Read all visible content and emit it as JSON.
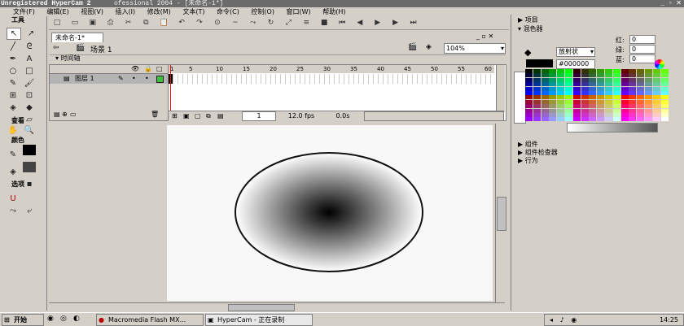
{
  "titlebar": {
    "title": "Unregistered HyperCam 2",
    "rest": "ofessional 2004 - [未命名-1*]"
  },
  "menu": [
    "文件(F)",
    "编辑(E)",
    "视图(V)",
    "插入(I)",
    "修改(M)",
    "文本(T)",
    "命令(C)",
    "控制(O)",
    "窗口(W)",
    "帮助(H)"
  ],
  "tools": {
    "title": "工具",
    "view_label": "查看",
    "colors_label": "颜色",
    "options_label": "选项"
  },
  "document": {
    "tab": "未命名-1*",
    "scene": "场景 1",
    "zoom": "104%"
  },
  "timeline": {
    "label": "时间轴",
    "layer": "图层 1",
    "frame": "1",
    "fps": "12.0 fps",
    "time": "0.0s",
    "ticks": [
      "1",
      "5",
      "10",
      "15",
      "20",
      "25",
      "30",
      "35",
      "40",
      "45",
      "50",
      "55",
      "60"
    ]
  },
  "right_panel": {
    "items_label": "项目",
    "mixer_label": "混色器",
    "fill_type": "放射状",
    "hex": "#000000",
    "red_label": "红:",
    "red": "0",
    "green_label": "绿:",
    "green": "0",
    "blue_label": "蓝:",
    "blue": "0",
    "components_label": "组件",
    "inspector_label": "组件检查器",
    "behaviors_label": "行为"
  },
  "taskbar": {
    "start": "开始",
    "task1": "Macromedia Flash MX...",
    "task2": "HyperCam - 正在录制",
    "clock": "14:25"
  }
}
